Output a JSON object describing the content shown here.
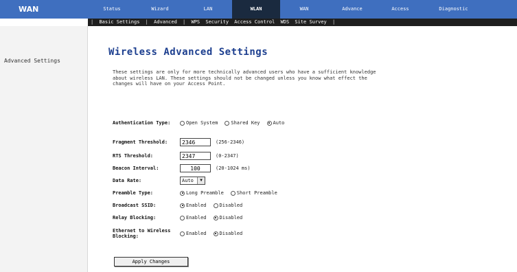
{
  "brand": "WAN",
  "tabs": [
    {
      "label": "Status"
    },
    {
      "label": "Wizard"
    },
    {
      "label": "LAN"
    },
    {
      "label": "WLAN"
    },
    {
      "label": "WAN"
    },
    {
      "label": "Advance"
    },
    {
      "label": "Access"
    },
    {
      "label": "Diagnostic"
    }
  ],
  "subnav": {
    "items": [
      "Basic Settings",
      "Advanced",
      "WPS",
      "Security",
      "Access Control",
      "WDS",
      "Site Survey"
    ],
    "separator": "|"
  },
  "sidebar": {
    "item": "Advanced Settings"
  },
  "page": {
    "title": "Wireless Advanced Settings",
    "description": "These settings are only for more technically advanced users who have a sufficient knowledge about wireless LAN. These settings should not be changed unless you know what effect the changes will have on your Access Point."
  },
  "form": {
    "auth_type": {
      "label": "Authentication Type:",
      "options": [
        "Open System",
        "Shared Key",
        "Auto"
      ],
      "selected": 2
    },
    "frag": {
      "label": "Fragment Threshold:",
      "value": "2346",
      "unit": "(256-2346)"
    },
    "rts": {
      "label": "RTS Threshold:",
      "value": "2347",
      "unit": "(0-2347)"
    },
    "beacon": {
      "label": "Beacon Interval:",
      "value": "100",
      "unit": "(20-1024 ms)"
    },
    "data_rate": {
      "label": "Data Rate:",
      "value": "Auto"
    },
    "preamble": {
      "label": "Preamble Type:",
      "options": [
        "Long Preamble",
        "Short Preamble"
      ],
      "selected": 0
    },
    "broadcast_ssid": {
      "label": "Broadcast SSID:",
      "options": [
        "Enabled",
        "Disabled"
      ],
      "selected": 0
    },
    "relay_blocking": {
      "label": "Relay Blocking:",
      "options": [
        "Enabled",
        "Disabled"
      ],
      "selected": 1
    },
    "ethernet_blocking": {
      "label": "Ethernet to Wireless Blocking:",
      "options": [
        "Enabled",
        "Disabled"
      ],
      "selected": 1
    }
  },
  "apply_label": "Apply Changes",
  "colors": {
    "tab_bar": "#3f6fbf",
    "active_tab": "#1a2a3f",
    "subnav": "#1f1f1f",
    "title": "#1d3f8f",
    "sidebar": "#f3f3f3"
  }
}
